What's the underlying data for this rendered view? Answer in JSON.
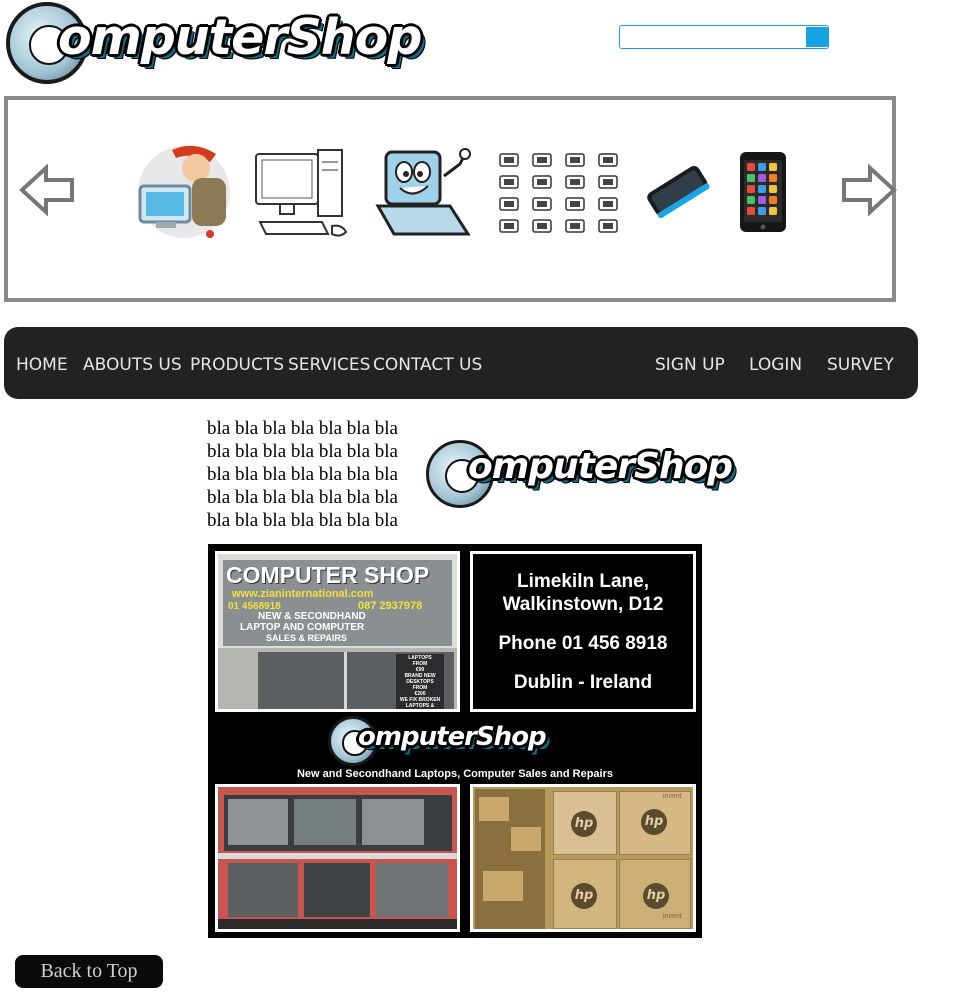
{
  "header": {
    "logo_text": "omputerShop",
    "search": {
      "placeholder": "",
      "value": ""
    }
  },
  "carousel": {
    "prev_icon": "left-arrow-icon",
    "next_icon": "right-arrow-icon",
    "slides": [
      {
        "icon": "technician-icon"
      },
      {
        "icon": "desktop-computer-icon"
      },
      {
        "icon": "laptop-cartoon-icon"
      },
      {
        "icon": "hardware-grid-icon"
      },
      {
        "icon": "smartphone-icon"
      },
      {
        "icon": "tablet-icon"
      }
    ]
  },
  "nav": {
    "left": [
      "HOME",
      "ABOUTS US",
      "PRODUCTS",
      "SERVICES",
      "CONTACT US"
    ],
    "right": [
      "SIGN UP",
      "LOGIN",
      "SURVEY"
    ]
  },
  "content": {
    "bla_lines": [
      "bla bla bla bla bla bla bla",
      "bla bla bla bla bla bla bla",
      "bla bla bla bla bla bla bla",
      "bla bla bla bla bla bla bla",
      "bla bla bla bla bla bla bla"
    ],
    "logo_text": "omputerShop"
  },
  "ad": {
    "storefront": {
      "sign_title": "COMPUTER SHOP",
      "sign_url": "www.zianinternational.com",
      "sign_phone1": "01 4568918",
      "sign_phone2": "087 2937978",
      "sign_line1": "NEW & SECONDHAND",
      "sign_line2": "LAPTOP AND COMPUTER",
      "sign_line3": "SALES & REPAIRS",
      "window_lines": [
        "LAPTOPS",
        "FROM",
        "€99",
        "BRAND NEW",
        "DESKTOPS",
        "FROM",
        "€200",
        "WE FIX BROKEN",
        "LAPTOPS &"
      ]
    },
    "address_line1": "Limekiln Lane,",
    "address_line2": "Walkinstown, D12",
    "phone": "Phone 01 456 8918",
    "location": "Dublin - Ireland",
    "logo_text": "omputerShop",
    "tagline": "New and Secondhand Laptops, Computer Sales and Repairs",
    "box_label": "hp",
    "box_sublabel": "invent"
  },
  "footer": {
    "back_to_top": "Back to Top"
  }
}
